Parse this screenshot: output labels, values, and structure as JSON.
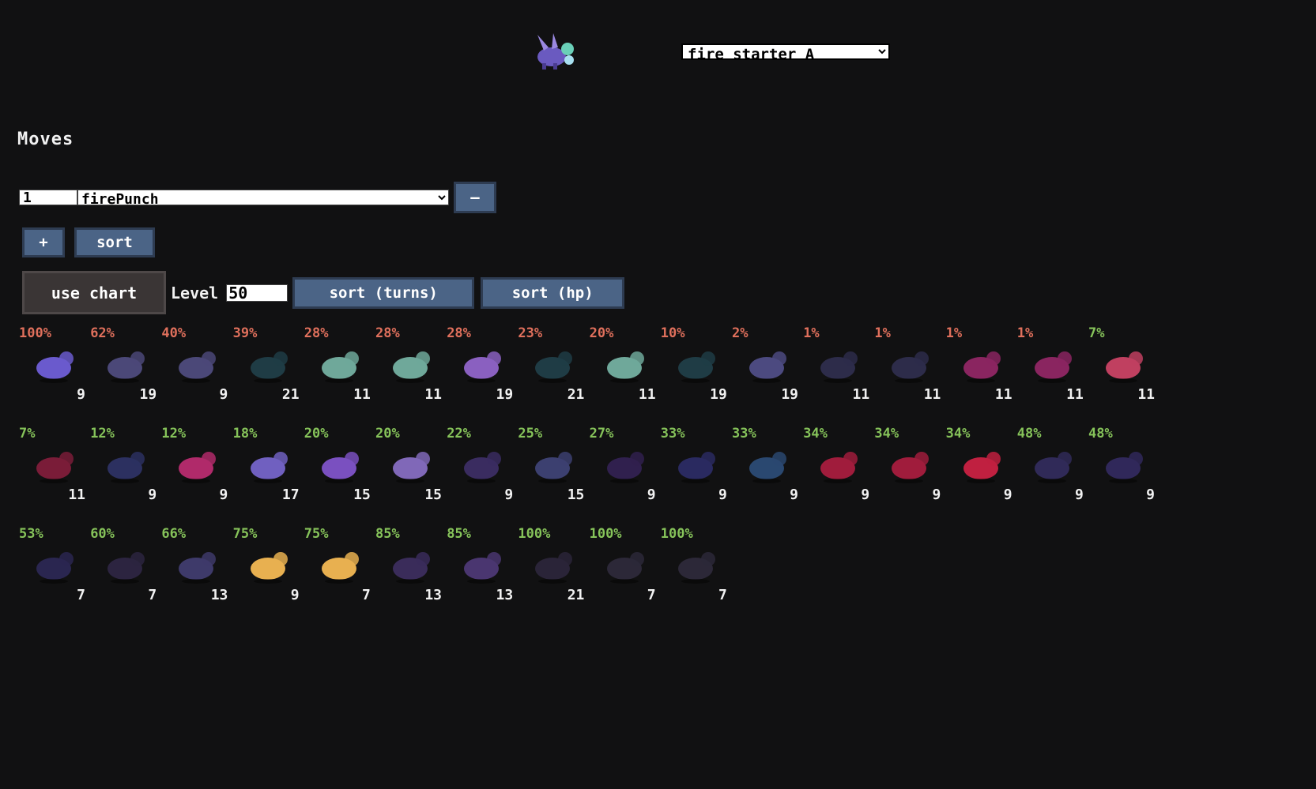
{
  "header": {
    "species_options": [
      "fire_starter_A"
    ],
    "species_selected": "fire_starter_A",
    "portrait_icon": "purple-bunny-sprite"
  },
  "moves": {
    "title": "Moves",
    "rows": [
      {
        "slot": "1",
        "move": "firePunch",
        "remove_label": "–"
      }
    ],
    "add_label": "+",
    "sort_label": "sort"
  },
  "controls": {
    "use_chart_label": "use chart",
    "level_label": "Level",
    "level_value": "50",
    "sort_turns_label": "sort (turns)",
    "sort_hp_label": "sort (hp)"
  },
  "colors": {
    "damage_high": "#e0705c",
    "damage_low": "#86c35a",
    "button": "#4b6486"
  },
  "opponents": [
    {
      "pct": "100%",
      "turns": "9",
      "tone": "red",
      "sprite": "wolf-monster",
      "color": "#6a5acd"
    },
    {
      "pct": "62%",
      "turns": "19",
      "tone": "red",
      "sprite": "toad-monster",
      "color": "#4b4878"
    },
    {
      "pct": "40%",
      "turns": "9",
      "tone": "red",
      "sprite": "toad-monster",
      "color": "#4b4878"
    },
    {
      "pct": "39%",
      "turns": "21",
      "tone": "red",
      "sprite": "shadow-lizard",
      "color": "#1f3c45"
    },
    {
      "pct": "28%",
      "turns": "11",
      "tone": "red",
      "sprite": "leaf-fox",
      "color": "#6fa89a"
    },
    {
      "pct": "28%",
      "turns": "11",
      "tone": "red",
      "sprite": "leaf-fox",
      "color": "#6fa89a"
    },
    {
      "pct": "28%",
      "turns": "19",
      "tone": "red",
      "sprite": "squid-monster",
      "color": "#8a60c0"
    },
    {
      "pct": "23%",
      "turns": "21",
      "tone": "red",
      "sprite": "shadow-lizard",
      "color": "#1f3c45"
    },
    {
      "pct": "20%",
      "turns": "11",
      "tone": "red",
      "sprite": "leaf-fox",
      "color": "#6fa89a"
    },
    {
      "pct": "10%",
      "turns": "19",
      "tone": "red",
      "sprite": "shadow-lizard",
      "color": "#1f3c45"
    },
    {
      "pct": "2%",
      "turns": "19",
      "tone": "red",
      "sprite": "crystal-golem",
      "color": "#4c4a80"
    },
    {
      "pct": "1%",
      "turns": "11",
      "tone": "red",
      "sprite": "vine-bear",
      "color": "#2d2c4a"
    },
    {
      "pct": "1%",
      "turns": "11",
      "tone": "red",
      "sprite": "vine-bear",
      "color": "#2d2c4a"
    },
    {
      "pct": "1%",
      "turns": "11",
      "tone": "red",
      "sprite": "crimson-rabbit",
      "color": "#8a2560"
    },
    {
      "pct": "1%",
      "turns": "11",
      "tone": "red",
      "sprite": "crimson-rabbit",
      "color": "#8a2560"
    },
    {
      "pct": "7%",
      "turns": "11",
      "tone": "green",
      "sprite": "flame-scorpion",
      "color": "#c04060"
    },
    {
      "pct": "7%",
      "turns": "11",
      "tone": "green",
      "sprite": "red-plant",
      "color": "#7a1c38"
    },
    {
      "pct": "12%",
      "turns": "9",
      "tone": "green",
      "sprite": "dark-imp",
      "color": "#2c3060"
    },
    {
      "pct": "12%",
      "turns": "9",
      "tone": "green",
      "sprite": "pink-ghost",
      "color": "#b02a6a"
    },
    {
      "pct": "18%",
      "turns": "17",
      "tone": "green",
      "sprite": "purple-bunny",
      "color": "#7060c0"
    },
    {
      "pct": "20%",
      "turns": "15",
      "tone": "green",
      "sprite": "purple-deer",
      "color": "#7a50c0"
    },
    {
      "pct": "20%",
      "turns": "15",
      "tone": "green",
      "sprite": "mint-deer",
      "color": "#8068b8"
    },
    {
      "pct": "22%",
      "turns": "9",
      "tone": "green",
      "sprite": "dark-imp",
      "color": "#3a2c60"
    },
    {
      "pct": "25%",
      "turns": "15",
      "tone": "green",
      "sprite": "crystal-golem",
      "color": "#3c4070"
    },
    {
      "pct": "27%",
      "turns": "9",
      "tone": "green",
      "sprite": "dark-imp",
      "color": "#30204e"
    },
    {
      "pct": "33%",
      "turns": "9",
      "tone": "green",
      "sprite": "shadow-serpent",
      "color": "#2a2a60"
    },
    {
      "pct": "33%",
      "turns": "9",
      "tone": "green",
      "sprite": "blue-serpent",
      "color": "#2a4870"
    },
    {
      "pct": "34%",
      "turns": "9",
      "tone": "green",
      "sprite": "flame-lizard",
      "color": "#a01c3c"
    },
    {
      "pct": "34%",
      "turns": "9",
      "tone": "green",
      "sprite": "flame-lizard",
      "color": "#a01c3c"
    },
    {
      "pct": "34%",
      "turns": "9",
      "tone": "green",
      "sprite": "fire-salamander",
      "color": "#c02040"
    },
    {
      "pct": "48%",
      "turns": "9",
      "tone": "green",
      "sprite": "shadow-swarm",
      "color": "#302a58"
    },
    {
      "pct": "48%",
      "turns": "9",
      "tone": "green",
      "sprite": "shadow-scorpion",
      "color": "#30285a"
    },
    {
      "pct": "53%",
      "turns": "7",
      "tone": "green",
      "sprite": "dark-snake",
      "color": "#2a2650"
    },
    {
      "pct": "60%",
      "turns": "7",
      "tone": "green",
      "sprite": "tiny-imp",
      "color": "#2c2440"
    },
    {
      "pct": "66%",
      "turns": "13",
      "tone": "green",
      "sprite": "toad-monster",
      "color": "#3e3a6a"
    },
    {
      "pct": "75%",
      "turns": "9",
      "tone": "green",
      "sprite": "yellow-flower",
      "color": "#e8b050"
    },
    {
      "pct": "75%",
      "turns": "7",
      "tone": "green",
      "sprite": "yellow-flower",
      "color": "#e8b050"
    },
    {
      "pct": "85%",
      "turns": "13",
      "tone": "green",
      "sprite": "spiky-hedgehog",
      "color": "#3a2c5a"
    },
    {
      "pct": "85%",
      "turns": "13",
      "tone": "green",
      "sprite": "spiky-hedgehog",
      "color": "#4a3670"
    },
    {
      "pct": "100%",
      "turns": "21",
      "tone": "green",
      "sprite": "shadow-turtle",
      "color": "#2a2438"
    },
    {
      "pct": "100%",
      "turns": "7",
      "tone": "green",
      "sprite": "palm-spider",
      "color": "#2c2838"
    },
    {
      "pct": "100%",
      "turns": "7",
      "tone": "green",
      "sprite": "palm-spider",
      "color": "#2c2838"
    }
  ]
}
